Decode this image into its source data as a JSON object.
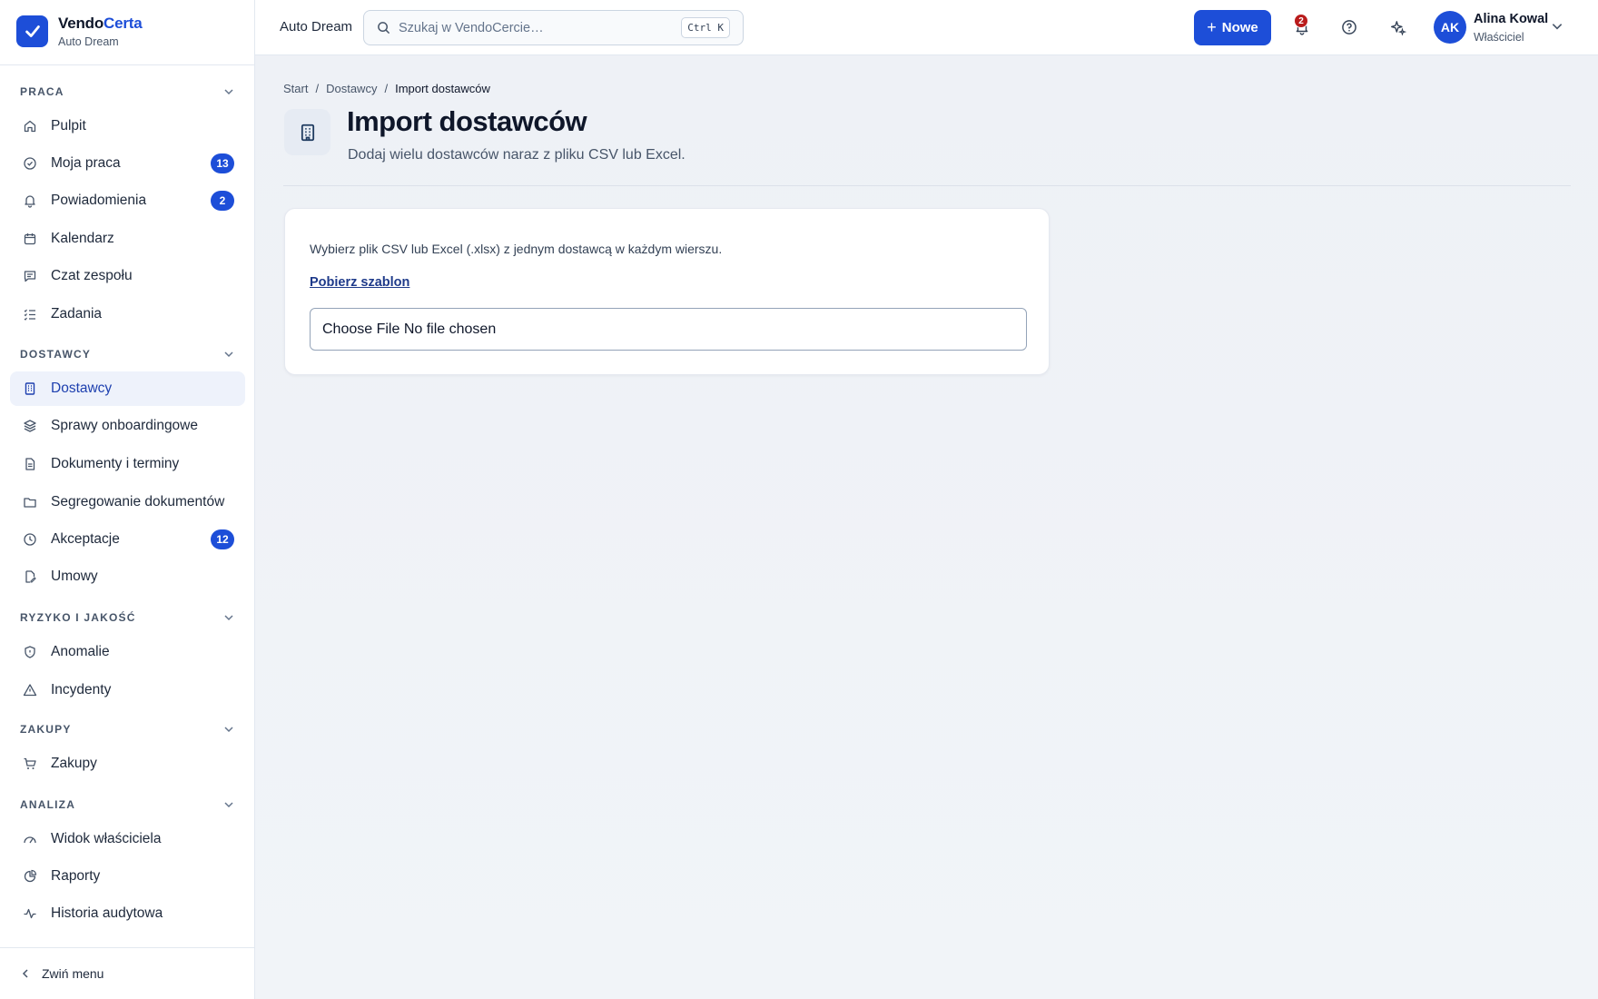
{
  "brand": {
    "name_a": "Vendo",
    "name_b": "Certa",
    "org": "Auto Dream"
  },
  "sidebar": {
    "sections": [
      {
        "label": "PRACA",
        "items": [
          {
            "label": "Pulpit",
            "icon": "home-icon"
          },
          {
            "label": "Moja praca",
            "icon": "check-circle-icon",
            "badge": "13"
          },
          {
            "label": "Powiadomienia",
            "icon": "bell-icon",
            "badge": "2"
          },
          {
            "label": "Kalendarz",
            "icon": "calendar-icon"
          },
          {
            "label": "Czat zespołu",
            "icon": "chat-icon"
          },
          {
            "label": "Zadania",
            "icon": "tasks-icon"
          }
        ]
      },
      {
        "label": "DOSTAWCY",
        "items": [
          {
            "label": "Dostawcy",
            "icon": "building-icon",
            "active": true
          },
          {
            "label": "Sprawy onboardingowe",
            "icon": "layers-icon"
          },
          {
            "label": "Dokumenty i terminy",
            "icon": "document-icon"
          },
          {
            "label": "Segregowanie dokumentów",
            "icon": "folder-icon"
          },
          {
            "label": "Akceptacje",
            "icon": "clock-icon",
            "badge": "12"
          },
          {
            "label": "Umowy",
            "icon": "contract-icon"
          }
        ]
      },
      {
        "label": "RYZYKO I JAKOŚĆ",
        "items": [
          {
            "label": "Anomalie",
            "icon": "shield-icon"
          },
          {
            "label": "Incydenty",
            "icon": "warning-icon"
          }
        ]
      },
      {
        "label": "ZAKUPY",
        "items": [
          {
            "label": "Zakupy",
            "icon": "cart-icon"
          }
        ]
      },
      {
        "label": "ANALIZA",
        "items": [
          {
            "label": "Widok właściciela",
            "icon": "gauge-icon"
          },
          {
            "label": "Raporty",
            "icon": "pie-chart-icon"
          },
          {
            "label": "Historia audytowa",
            "icon": "activity-icon"
          }
        ]
      }
    ],
    "collapse_label": "Zwiń menu"
  },
  "topbar": {
    "org": "Auto Dream",
    "search_placeholder": "Szukaj w VendoCercie…",
    "shortcut": "Ctrl K",
    "new_label": "Nowe",
    "notifications_count": "2",
    "user": {
      "initials": "AK",
      "name": "Alina Kowal",
      "role": "Właściciel"
    }
  },
  "page": {
    "breadcrumb": [
      "Start",
      "Dostawcy",
      "Import dostawców"
    ],
    "title": "Import dostawców",
    "subtitle": "Dodaj wielu dostawców naraz z pliku CSV lub Excel.",
    "card": {
      "description": "Wybierz plik CSV lub Excel (.xlsx) z jednym dostawcą w każdym wierszu.",
      "template_link": "Pobierz szablon",
      "file_input_text": "Choose File No file chosen"
    }
  },
  "colors": {
    "accent": "#1d4ed8",
    "notif_badge": "#b91c1c"
  }
}
